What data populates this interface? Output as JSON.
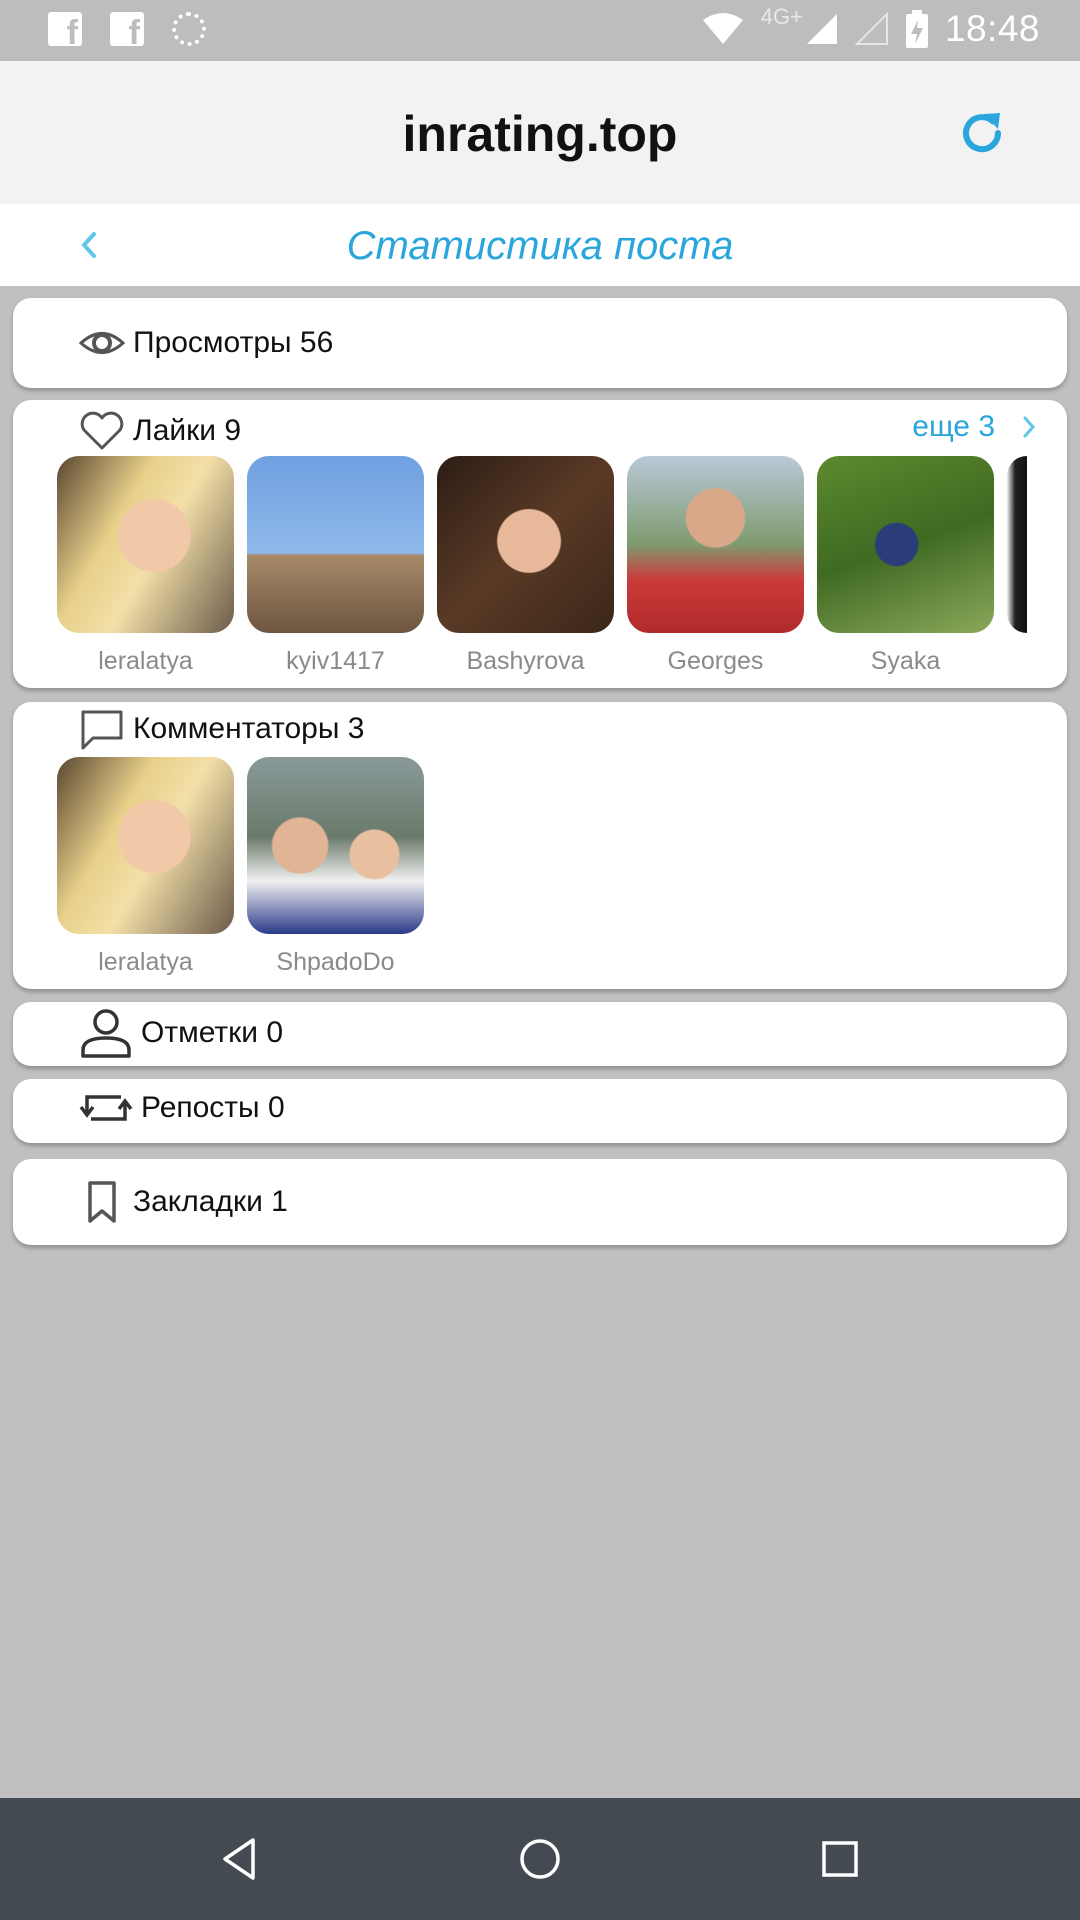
{
  "status_bar": {
    "time": "18:48",
    "network": "4G+",
    "left_icons": [
      "facebook-icon",
      "facebook-icon",
      "loading-icon"
    ],
    "right_icons": [
      "wifi-icon",
      "signal-icon",
      "signal-empty-icon",
      "battery-icon"
    ]
  },
  "app": {
    "title": "inrating.top",
    "refresh_icon": "refresh-icon",
    "accent_color": "#2ba6dd"
  },
  "subheader": {
    "title": "Статистика поста",
    "back_icon": "chevron-left-icon"
  },
  "views": {
    "label": "Просмотры 56",
    "icon": "eye-icon"
  },
  "likes": {
    "label": "Лайки 9",
    "icon": "heart-icon",
    "more_label": "еще 3",
    "users": [
      {
        "name": "leralatya"
      },
      {
        "name": "kyiv1417"
      },
      {
        "name": "Bashyrova"
      },
      {
        "name": "Georges"
      },
      {
        "name": "Syaka"
      }
    ]
  },
  "commenters": {
    "label": "Комментаторы 3",
    "icon": "comment-icon",
    "users": [
      {
        "name": "leralatya"
      },
      {
        "name": "ShpadoDo"
      }
    ]
  },
  "tags": {
    "label": "Отметки 0",
    "icon": "person-icon"
  },
  "reposts": {
    "label": "Репосты 0",
    "icon": "repost-icon"
  },
  "bookmarks": {
    "label": "Закладки 1",
    "icon": "bookmark-icon"
  },
  "nav_bar": {
    "buttons": [
      "back-triangle-icon",
      "home-circle-icon",
      "recents-square-icon"
    ]
  }
}
